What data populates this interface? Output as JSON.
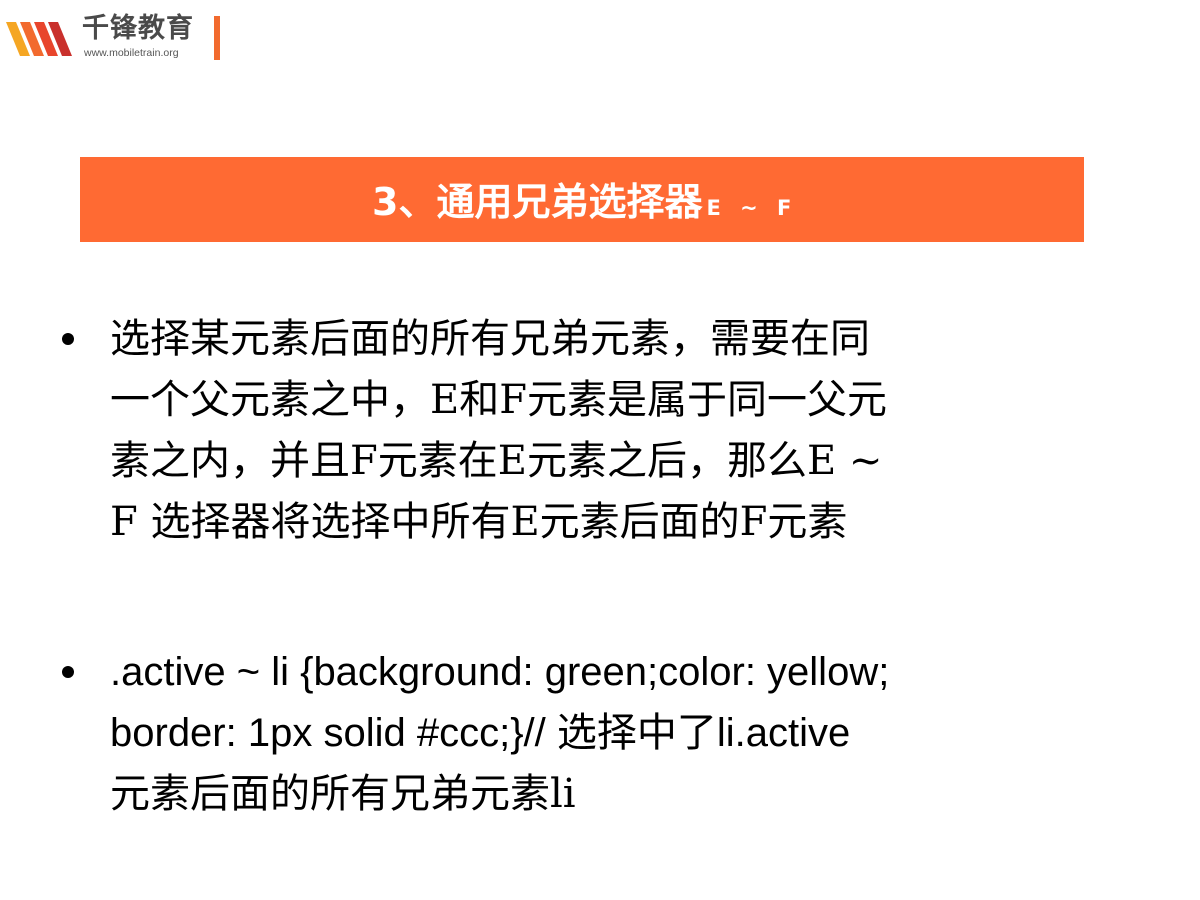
{
  "logo": {
    "name": "千锋教育",
    "url": "www.mobiletrain.org",
    "accent_color": "#f26a2e",
    "mark_icon": "mobiletrain-logo-icon"
  },
  "title": {
    "main": "3、通用兄弟选择器",
    "suffix": "E ~ F",
    "banner_color": "#ff6a33",
    "text_color": "#ffffff"
  },
  "bullets": [
    {
      "lines": [
        "选择某元素后面的所有兄弟元素，需要在同",
        "一个父元素之中，E和F元素是属于同一父元",
        "素之内，并且F元素在E元素之后，那么E ~",
        "F 选择器将选择中所有E元素后面的F元素"
      ]
    },
    {
      "lines": [
        ".active ~ li {background: green;color: yellow;",
        "border: 1px solid #ccc;}// 选择中了li.active",
        "元素后面的所有兄弟元素li"
      ]
    }
  ]
}
